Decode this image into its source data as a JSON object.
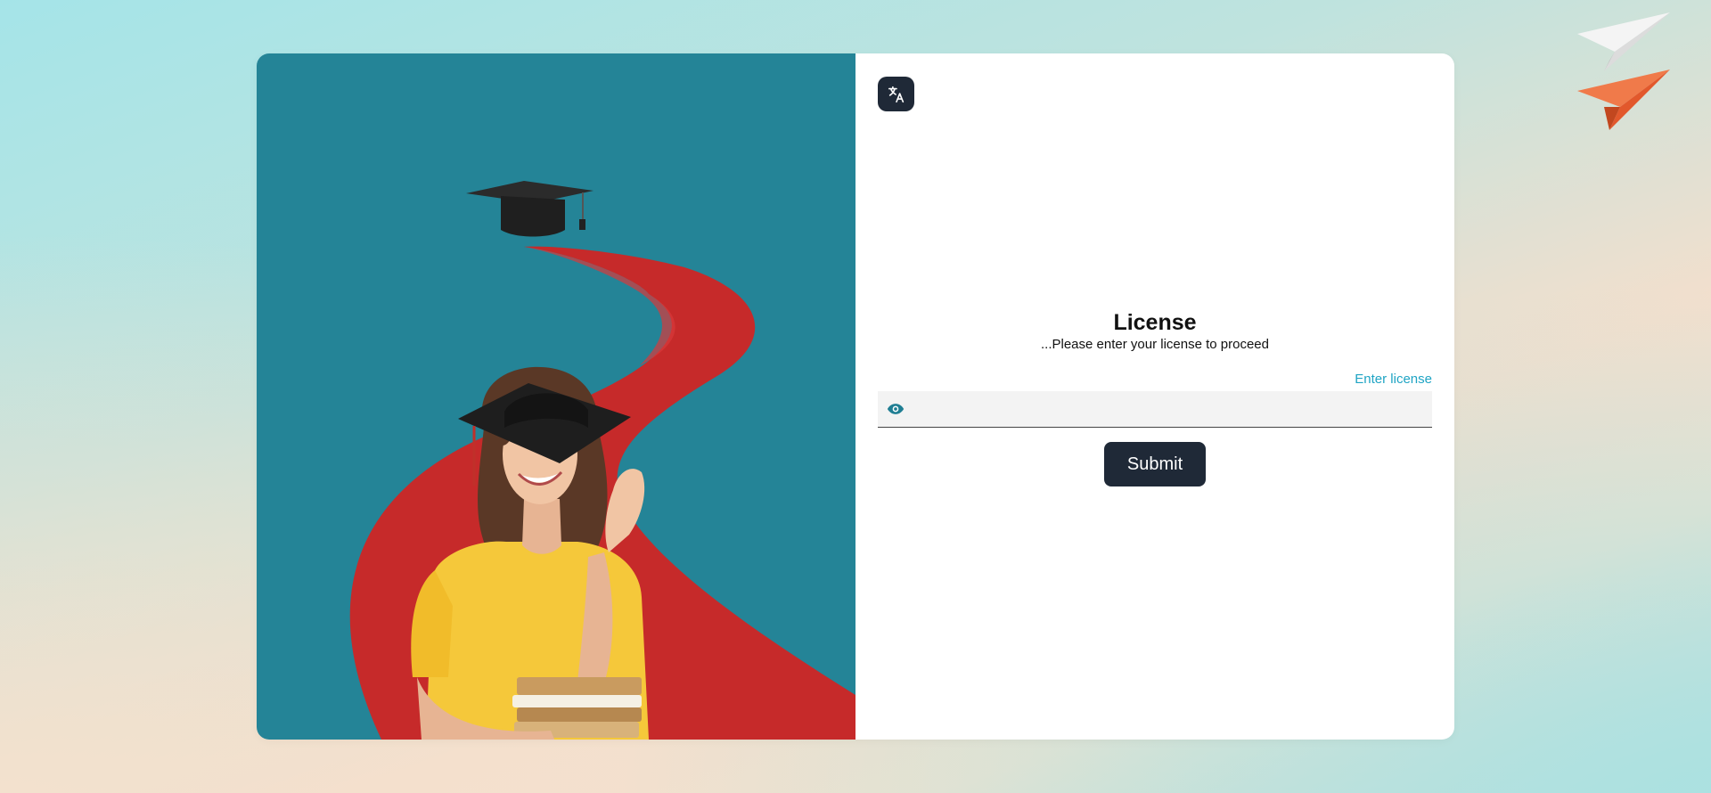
{
  "form": {
    "title": "License",
    "subtitle": "...Please enter your license to proceed",
    "field_label": "Enter license",
    "input_value": "",
    "input_placeholder": "",
    "submit_label": "Submit"
  },
  "icons": {
    "language": "translate-icon",
    "password_toggle": "eye-icon",
    "decoration": "paper-plane-icon"
  },
  "colors": {
    "panel_teal": "#248497",
    "button_dark": "#1f2937",
    "link_blue": "#1fa4c4",
    "road_red": "#c62a2a",
    "shirt_yellow": "#f5c83a"
  }
}
